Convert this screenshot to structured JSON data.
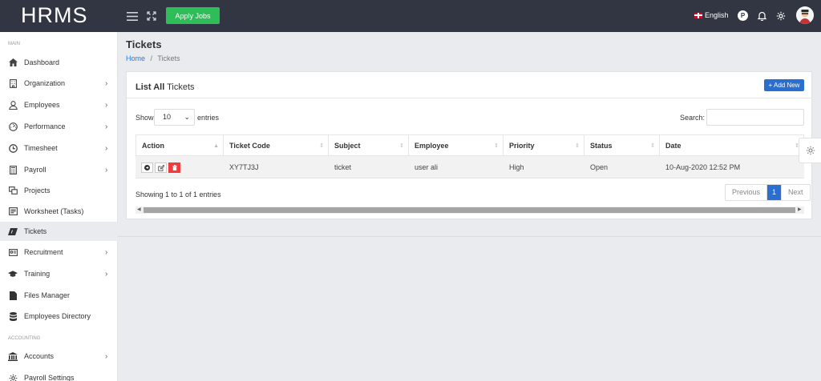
{
  "topbar": {
    "brand": "HRMS",
    "apply_jobs": "Apply Jobs",
    "language": "English",
    "p_badge": "P"
  },
  "sidebar": {
    "section_main": "MAIN",
    "section_accounting": "ACCOUNTING",
    "items": [
      {
        "label": "Dashboard",
        "icon": "home-icon",
        "has_children": false
      },
      {
        "label": "Organization",
        "icon": "building-icon",
        "has_children": true
      },
      {
        "label": "Employees",
        "icon": "user-icon",
        "has_children": true
      },
      {
        "label": "Performance",
        "icon": "gauge-icon",
        "has_children": true
      },
      {
        "label": "Timesheet",
        "icon": "clock-icon",
        "has_children": true
      },
      {
        "label": "Payroll",
        "icon": "calculator-icon",
        "has_children": true
      },
      {
        "label": "Projects",
        "icon": "projects-icon",
        "has_children": false
      },
      {
        "label": "Worksheet (Tasks)",
        "icon": "worksheet-icon",
        "has_children": false
      },
      {
        "label": "Tickets",
        "icon": "ticket-icon",
        "has_children": false,
        "active": true
      },
      {
        "label": "Recruitment",
        "icon": "recruitment-icon",
        "has_children": true
      },
      {
        "label": "Training",
        "icon": "graduation-cap-icon",
        "has_children": true
      },
      {
        "label": "Files Manager",
        "icon": "file-icon",
        "has_children": false
      },
      {
        "label": "Employees Directory",
        "icon": "database-icon",
        "has_children": false
      }
    ],
    "accounting_items": [
      {
        "label": "Accounts",
        "icon": "bank-icon",
        "has_children": true
      },
      {
        "label": "Payroll Settings",
        "icon": "settings-icon",
        "has_children": false
      }
    ]
  },
  "page": {
    "title": "Tickets",
    "breadcrumb_home": "Home",
    "breadcrumb_sep": "/",
    "breadcrumb_current": "Tickets"
  },
  "card": {
    "title_bold": "List All",
    "title_rest": " Tickets",
    "add_new": "+ Add New",
    "show_label": "Show",
    "show_value": "10",
    "entries_label": "entries",
    "search_label": "Search:",
    "showing": "Showing 1 to 1 of 1 entries",
    "pager": {
      "previous": "Previous",
      "current": "1",
      "next": "Next"
    }
  },
  "table": {
    "columns": [
      "Action",
      "Ticket Code",
      "Subject",
      "Employee",
      "Priority",
      "Status",
      "Date"
    ],
    "rows": [
      {
        "ticket_code": "XY7TJ3J",
        "subject": "ticket",
        "employee": "user ali",
        "priority": "High",
        "status": "Open",
        "date": "10-Aug-2020 12:52 PM"
      }
    ]
  },
  "colors": {
    "topbar": "#323642",
    "apply_button": "#2ebd59",
    "primary": "#2a6fcf",
    "delete": "#f23b3b"
  }
}
